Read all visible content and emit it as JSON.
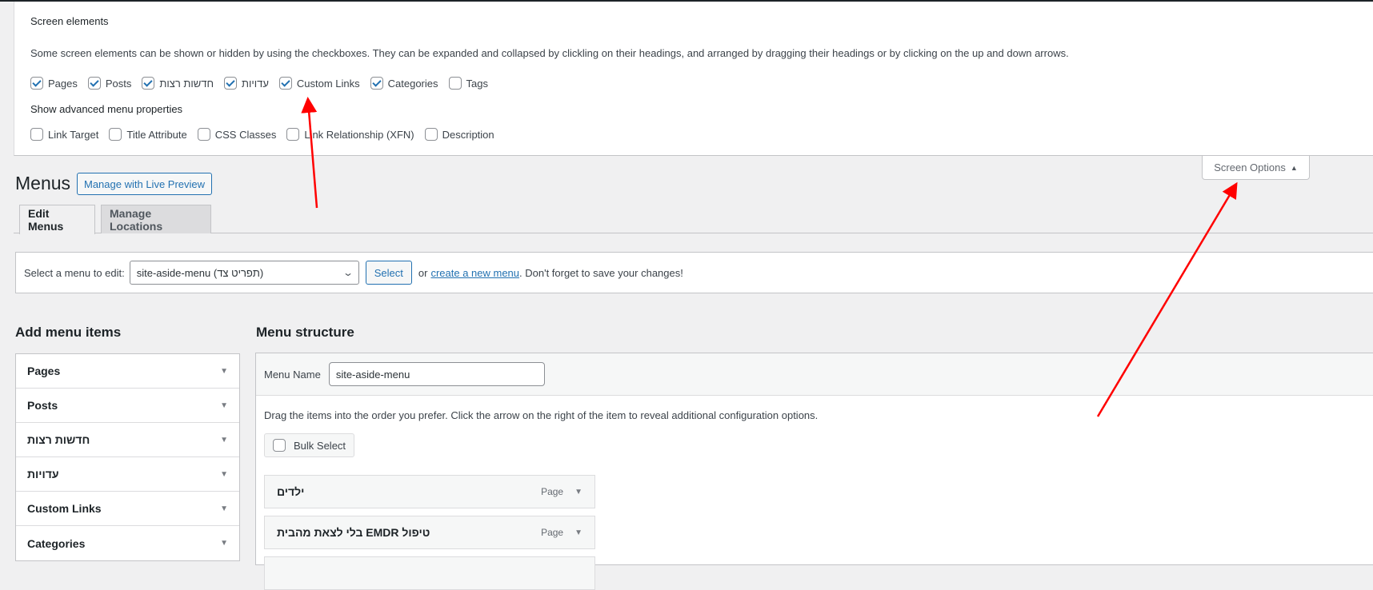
{
  "screen_options": {
    "heading": "Screen elements",
    "description": "Some screen elements can be shown or hidden by using the checkboxes. They can be expanded and collapsed by clickling on their headings, and arranged by dragging their headings or by clicking on the up and down arrows.",
    "elements": [
      {
        "label": "Pages",
        "checked": true
      },
      {
        "label": "Posts",
        "checked": true
      },
      {
        "label": "חדשות רצות",
        "checked": true
      },
      {
        "label": "עדויות",
        "checked": true
      },
      {
        "label": "Custom Links",
        "checked": true
      },
      {
        "label": "Categories",
        "checked": true
      },
      {
        "label": "Tags",
        "checked": false
      }
    ],
    "advanced_heading": "Show advanced menu properties",
    "advanced": [
      {
        "label": "Link Target",
        "checked": false
      },
      {
        "label": "Title Attribute",
        "checked": false
      },
      {
        "label": "CSS Classes",
        "checked": false
      },
      {
        "label": "Link Relationship (XFN)",
        "checked": false
      },
      {
        "label": "Description",
        "checked": false
      }
    ],
    "tab_label": "Screen Options",
    "tab_icon": "triangle-up-icon"
  },
  "header": {
    "title": "Menus",
    "live_preview_label": "Manage with Live Preview"
  },
  "tabs": [
    {
      "label": "Edit Menus",
      "active": true
    },
    {
      "label": "Manage Locations",
      "active": false
    }
  ],
  "manage_bar": {
    "select_label": "Select a menu to edit:",
    "selected_menu": "site-aside-menu (תפריט צד)",
    "select_button": "Select",
    "or_text": "or",
    "create_link": "create a new menu",
    "reminder": ". Don't forget to save your changes!"
  },
  "add_items": {
    "title": "Add menu items",
    "sections": [
      {
        "label": "Pages"
      },
      {
        "label": "Posts"
      },
      {
        "label": "חדשות רצות"
      },
      {
        "label": "עדויות"
      },
      {
        "label": "Custom Links"
      },
      {
        "label": "Categories"
      }
    ]
  },
  "structure": {
    "title": "Menu structure",
    "menu_name_label": "Menu Name",
    "menu_name_value": "site-aside-menu",
    "drag_hint": "Drag the items into the order you prefer. Click the arrow on the right of the item to reveal additional configuration options.",
    "bulk_select_label": "Bulk Select",
    "items": [
      {
        "title": "ילדים",
        "type": "Page"
      },
      {
        "title": "טיפול EMDR בלי לצאת מהבית",
        "type": "Page"
      },
      {
        "title": "",
        "type": ""
      }
    ]
  },
  "colors": {
    "accent": "#2271b1",
    "annotation": "#ff0000",
    "background": "#f0f0f1"
  }
}
